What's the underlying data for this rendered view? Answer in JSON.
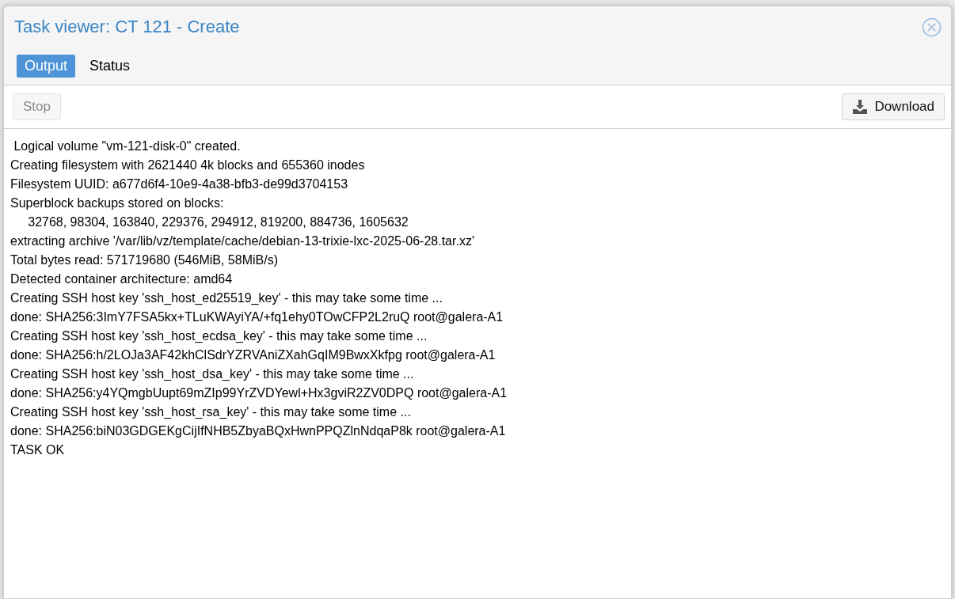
{
  "window": {
    "title": "Task viewer: CT 121 - Create"
  },
  "tabs": [
    {
      "label": "Output",
      "selected": true
    },
    {
      "label": "Status",
      "selected": false
    }
  ],
  "toolbar": {
    "stop_button": {
      "label": "Stop",
      "disabled": true
    },
    "download_button": {
      "label": "Download",
      "disabled": false
    }
  },
  "log": [
    " Logical volume \"vm-121-disk-0\" created.",
    "Creating filesystem with 2621440 4k blocks and 655360 inodes",
    "Filesystem UUID: a677d6f4-10e9-4a38-bfb3-de99d3704153",
    "Superblock backups stored on blocks:",
    "\t32768, 98304, 163840, 229376, 294912, 819200, 884736, 1605632",
    "extracting archive '/var/lib/vz/template/cache/debian-13-trixie-lxc-2025-06-28.tar.xz'",
    "Total bytes read: 571719680 (546MiB, 58MiB/s)",
    "Detected container architecture: amd64",
    "Creating SSH host key 'ssh_host_ed25519_key' - this may take some time ...",
    "done: SHA256:3ImY7FSA5kx+TLuKWAyiYA/+fq1ehy0TOwCFP2L2ruQ root@galera-A1",
    "Creating SSH host key 'ssh_host_ecdsa_key' - this may take some time ...",
    "done: SHA256:h/2LOJa3AF42khClSdrYZRVAniZXahGqIM9BwxXkfpg root@galera-A1",
    "Creating SSH host key 'ssh_host_dsa_key' - this may take some time ...",
    "done: SHA256:y4YQmgbUupt69mZIp99YrZVDYewl+Hx3gviR2ZV0DPQ root@galera-A1",
    "Creating SSH host key 'ssh_host_rsa_key' - this may take some time ...",
    "done: SHA256:biN03GDGEKgCijIfNHB5ZbyaBQxHwnPPQZlnNdqaP8k root@galera-A1",
    "TASK OK"
  ]
}
